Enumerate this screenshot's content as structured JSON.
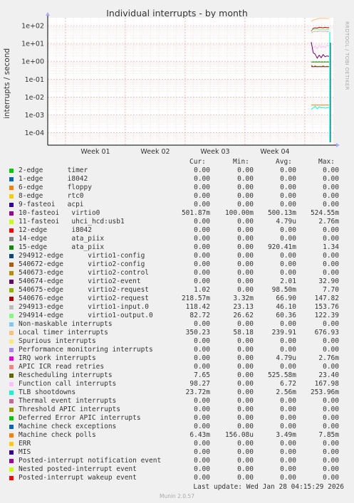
{
  "chart_data": {
    "type": "line",
    "title": "Individual interrupts - by month",
    "ylabel": "interrupts / second",
    "yscale": "log",
    "ylim": [
      0.0001,
      300
    ],
    "yticks": [
      "1e+02",
      "1e+01",
      "1e+00",
      "1e-01",
      "1e-02",
      "1e-03",
      "1e-04"
    ],
    "xticks": [
      "Week 01",
      "Week 02",
      "Week 03",
      "Week 04"
    ],
    "grid": true
  },
  "side_label": "RRDTOOL / TOBI OETIKER",
  "columns": [
    "Cur:",
    "Min:",
    "Avg:",
    "Max:"
  ],
  "series": [
    {
      "name": "2-edge      timer",
      "color": "#00cc00",
      "cur": "0.00",
      "min": "0.00",
      "avg": "0.00",
      "max": "0.00"
    },
    {
      "name": "1-edge      i8042",
      "color": "#0066b3",
      "cur": "0.00",
      "min": "0.00",
      "avg": "0.00",
      "max": "0.00"
    },
    {
      "name": "6-edge      floppy",
      "color": "#ff8000",
      "cur": "0.00",
      "min": "0.00",
      "avg": "0.00",
      "max": "0.00"
    },
    {
      "name": "8-edge      rtc0",
      "color": "#ffcc00",
      "cur": "0.00",
      "min": "0.00",
      "avg": "0.00",
      "max": "0.00"
    },
    {
      "name": "9-fasteoi   acpi",
      "color": "#330099",
      "cur": "0.00",
      "min": "0.00",
      "avg": "0.00",
      "max": "0.00"
    },
    {
      "name": "10-fasteoi   virtio0",
      "color": "#990099",
      "cur": "501.87m",
      "min": "100.00m",
      "avg": "500.13m",
      "max": "524.55m"
    },
    {
      "name": "11-fasteoi   uhci_hcd:usb1",
      "color": "#ccff00",
      "cur": "0.00",
      "min": "0.00",
      "avg": "4.79u",
      "max": "2.76m"
    },
    {
      "name": "12-edge      i8042",
      "color": "#ff0000",
      "cur": "0.00",
      "min": "0.00",
      "avg": "0.00",
      "max": "0.00"
    },
    {
      "name": "14-edge      ata_piix",
      "color": "#808080",
      "cur": "0.00",
      "min": "0.00",
      "avg": "0.00",
      "max": "0.00"
    },
    {
      "name": "15-edge      ata_piix",
      "color": "#008f00",
      "cur": "0.00",
      "min": "0.00",
      "avg": "920.41m",
      "max": "1.34"
    },
    {
      "name": "294912-edge      virtio1-config",
      "color": "#00487d",
      "cur": "0.00",
      "min": "0.00",
      "avg": "0.00",
      "max": "0.00"
    },
    {
      "name": "540672-edge      virtio2-config",
      "color": "#b35a00",
      "cur": "0.00",
      "min": "0.00",
      "avg": "0.00",
      "max": "0.00"
    },
    {
      "name": "540673-edge      virtio2-control",
      "color": "#b38f00",
      "cur": "0.00",
      "min": "0.00",
      "avg": "0.00",
      "max": "0.00"
    },
    {
      "name": "540674-edge      virtio2-event",
      "color": "#6b006b",
      "cur": "0.00",
      "min": "0.00",
      "avg": "2.01",
      "max": "32.90"
    },
    {
      "name": "540675-edge      virtio2-request",
      "color": "#8fb300",
      "cur": "1.02",
      "min": "0.00",
      "avg": "98.50m",
      "max": "7.70"
    },
    {
      "name": "540676-edge      virtio2-request",
      "color": "#b30000",
      "cur": "218.57m",
      "min": "3.32m",
      "avg": "66.90",
      "max": "147.82"
    },
    {
      "name": "294913-edge      virtio1-input.0",
      "color": "#bebebe",
      "cur": "118.42",
      "min": "23.13",
      "avg": "46.10",
      "max": "153.76"
    },
    {
      "name": "294914-edge      virtio1-output.0",
      "color": "#80ff80",
      "cur": "82.72",
      "min": "26.62",
      "avg": "60.36",
      "max": "122.39"
    },
    {
      "name": "Non-maskable interrupts",
      "color": "#80c9ff",
      "cur": "0.00",
      "min": "0.00",
      "avg": "0.00",
      "max": "0.00"
    },
    {
      "name": "Local timer interrupts",
      "color": "#ffc080",
      "cur": "350.23",
      "min": "58.18",
      "avg": "239.91",
      "max": "676.93"
    },
    {
      "name": "Spurious interrupts",
      "color": "#ffe680",
      "cur": "0.00",
      "min": "0.00",
      "avg": "0.00",
      "max": "0.00"
    },
    {
      "name": "Performance monitoring interrupts",
      "color": "#aa80ff",
      "cur": "0.00",
      "min": "0.00",
      "avg": "0.00",
      "max": "0.00"
    },
    {
      "name": "IRQ work interrupts",
      "color": "#ee00cc",
      "cur": "0.00",
      "min": "0.00",
      "avg": "4.79u",
      "max": "2.76m"
    },
    {
      "name": "APIC ICR read retries",
      "color": "#ff8080",
      "cur": "0.00",
      "min": "0.00",
      "avg": "0.00",
      "max": "0.00"
    },
    {
      "name": "Rescheduling interrupts",
      "color": "#666600",
      "cur": "7.65",
      "min": "0.00",
      "avg": "525.58m",
      "max": "23.40"
    },
    {
      "name": "Function call interrupts",
      "color": "#ffbfff",
      "cur": "98.27",
      "min": "0.00",
      "avg": "6.72",
      "max": "167.98"
    },
    {
      "name": "TLB shootdowns",
      "color": "#00ffcc",
      "cur": "23.72m",
      "min": "0.00",
      "avg": "2.56m",
      "max": "253.96m"
    },
    {
      "name": "Thermal event interrupts",
      "color": "#cc6699",
      "cur": "0.00",
      "min": "0.00",
      "avg": "0.00",
      "max": "0.00"
    },
    {
      "name": "Threshold APIC interrupts",
      "color": "#999900",
      "cur": "0.00",
      "min": "0.00",
      "avg": "0.00",
      "max": "0.00"
    },
    {
      "name": "Deferred Error APIC interrupts",
      "color": "#00cc00",
      "cur": "0.00",
      "min": "0.00",
      "avg": "0.00",
      "max": "0.00"
    },
    {
      "name": "Machine check exceptions",
      "color": "#0066b3",
      "cur": "0.00",
      "min": "0.00",
      "avg": "0.00",
      "max": "0.00"
    },
    {
      "name": "Machine check polls",
      "color": "#ff8000",
      "cur": "6.43m",
      "min": "156.08u",
      "avg": "3.49m",
      "max": "7.85m"
    },
    {
      "name": "ERR",
      "color": "#ffcc00",
      "cur": "0.00",
      "min": "0.00",
      "avg": "0.00",
      "max": "0.00"
    },
    {
      "name": "MIS",
      "color": "#330099",
      "cur": "0.00",
      "min": "0.00",
      "avg": "0.00",
      "max": "0.00"
    },
    {
      "name": "Posted-interrupt notification event",
      "color": "#990099",
      "cur": "0.00",
      "min": "0.00",
      "avg": "0.00",
      "max": "0.00"
    },
    {
      "name": "Nested posted-interrupt event",
      "color": "#ccff00",
      "cur": "0.00",
      "min": "0.00",
      "avg": "0.00",
      "max": "0.00"
    },
    {
      "name": "Posted-interrupt wakeup event",
      "color": "#ff0000",
      "cur": "0.00",
      "min": "0.00",
      "avg": "0.00",
      "max": "0.00"
    }
  ],
  "last_update": "Last update: Wed Jan 28 04:15:29 2026",
  "footer_version": "Munin 2.0.57"
}
